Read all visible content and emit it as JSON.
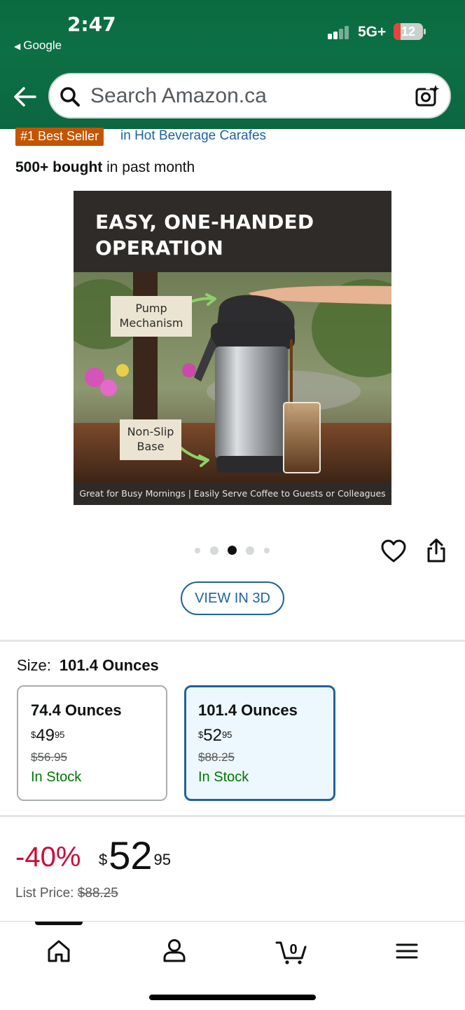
{
  "status_bar": {
    "time": "2:47",
    "back_app": "Google",
    "network": "5G+",
    "battery": "12",
    "battery_color": "#e5453a"
  },
  "header": {
    "background": "#0a6b3f",
    "back_icon": "back-arrow-icon",
    "search_placeholder": "Search Amazon.ca",
    "search_icon": "search-icon",
    "camera_icon": "camera-search-icon"
  },
  "product": {
    "best_seller_badge": "#1 Best Seller",
    "best_seller_category": "in Hot Beverage Carafes",
    "bought_bold": "500+ bought",
    "bought_rest": " in past month",
    "image": {
      "headline": "EASY, ONE-HANDED OPERATION",
      "label_pump_line1": "Pump",
      "label_pump_line2": "Mechanism",
      "label_base_line1": "Non-Slip",
      "label_base_line2": "Base",
      "caption": "Great for Busy Mornings | Easily Serve Coffee to Guests or Colleagues"
    },
    "carousel": {
      "total": 5,
      "active": 3
    },
    "view_3d_label": "VIEW IN 3D"
  },
  "size": {
    "label": "Size:",
    "selected": "101.4 Ounces",
    "options": [
      {
        "name": "74.4 Ounces",
        "currency": "$",
        "whole": "49",
        "fraction": "95",
        "list_price": "$56.95",
        "stock": "In Stock"
      },
      {
        "name": "101.4 Ounces",
        "currency": "$",
        "whole": "52",
        "fraction": "95",
        "list_price": "$88.25",
        "stock": "In Stock"
      }
    ]
  },
  "pricing": {
    "discount": "-40%",
    "currency": "$",
    "whole": "52",
    "fraction": "95",
    "list_price_label": "List Price:",
    "list_price": "$88.25",
    "discount_color": "#cc0c39"
  },
  "tabbar": {
    "items": [
      "home-icon",
      "account-icon",
      "cart-icon",
      "menu-icon"
    ],
    "cart_count": "0",
    "active": "home"
  }
}
